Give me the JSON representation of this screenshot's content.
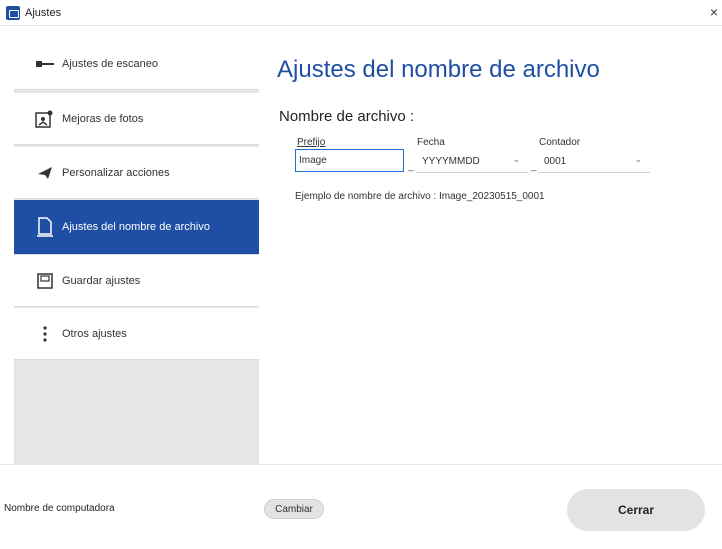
{
  "window": {
    "title": "Ajustes",
    "close_glyph": "×"
  },
  "sidebar": {
    "items": [
      {
        "label": "Ajustes de escaneo",
        "icon": "scan-settings-icon"
      },
      {
        "label": "Mejoras de fotos",
        "icon": "photo-enhance-icon"
      },
      {
        "label": "Personalizar acciones",
        "icon": "customize-actions-icon"
      },
      {
        "label": "Ajustes del nombre de archivo",
        "icon": "file-name-icon",
        "active": true
      },
      {
        "label": "Guardar ajustes",
        "icon": "save-settings-icon"
      },
      {
        "label": "Otros ajustes",
        "icon": "other-settings-icon"
      }
    ]
  },
  "main": {
    "heading": "Ajustes del nombre de archivo",
    "section_title": "Nombre de archivo :",
    "prefix": {
      "label": "Prefijo",
      "value": "Image"
    },
    "date": {
      "label": "Fecha",
      "value": "YYYYMMDD"
    },
    "counter": {
      "label": "Contador",
      "value": "0001"
    },
    "separator": "_",
    "example": "Ejemplo de nombre de archivo : Image_20230515_0001"
  },
  "footer": {
    "computer_name_label": "Nombre de computadora",
    "change_button": "Cambiar",
    "close_button": "Cerrar"
  },
  "colors": {
    "accent": "#1f4fa5",
    "sidebar_bg": "#e6e6e6",
    "button_bg": "#e3e3e3"
  }
}
